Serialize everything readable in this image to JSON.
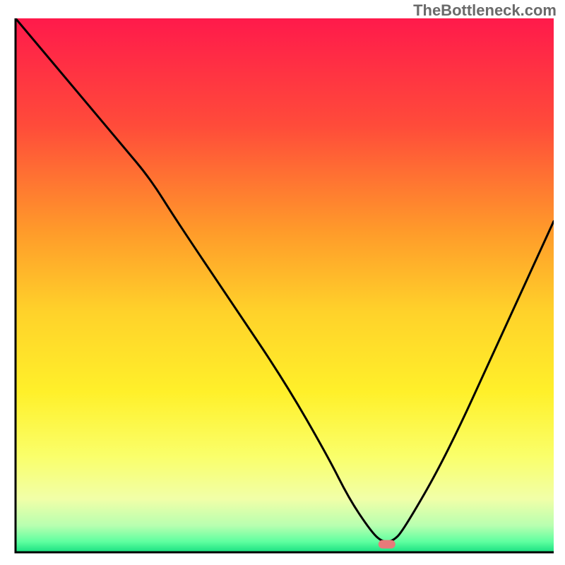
{
  "watermark": "TheBottleneck.com",
  "chart_data": {
    "type": "line",
    "title": "",
    "xlabel": "",
    "ylabel": "",
    "xlim": [
      0,
      100
    ],
    "ylim": [
      0,
      100
    ],
    "series": [
      {
        "name": "curve",
        "x": [
          0,
          10,
          20,
          25,
          30,
          40,
          50,
          58,
          62,
          66,
          68,
          70,
          72,
          80,
          90,
          100
        ],
        "y": [
          100,
          88,
          76,
          70,
          62,
          47,
          32,
          18,
          10,
          4,
          2,
          2,
          4,
          18,
          40,
          62
        ]
      }
    ],
    "marker": {
      "x": 69,
      "y": 1.5
    },
    "gradient_stops": [
      {
        "offset": 0,
        "color": "#ff1a4b"
      },
      {
        "offset": 20,
        "color": "#ff4b3a"
      },
      {
        "offset": 40,
        "color": "#ff9b2a"
      },
      {
        "offset": 55,
        "color": "#ffd22a"
      },
      {
        "offset": 70,
        "color": "#fff02a"
      },
      {
        "offset": 82,
        "color": "#faff6a"
      },
      {
        "offset": 90,
        "color": "#f1ffa8"
      },
      {
        "offset": 95,
        "color": "#b8ffb0"
      },
      {
        "offset": 98,
        "color": "#5fffa0"
      },
      {
        "offset": 100,
        "color": "#18e080"
      }
    ],
    "axes_color": "#000000",
    "line_color": "#000000",
    "marker_color": "#e77a7a"
  }
}
